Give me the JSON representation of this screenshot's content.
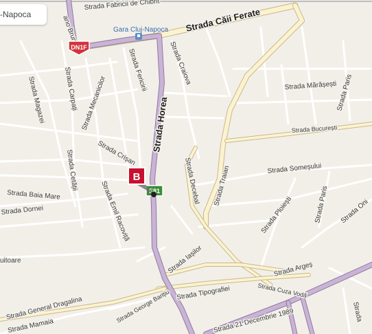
{
  "search_text": "-Napoca",
  "marker": {
    "label": "B",
    "color": "#c8102e"
  },
  "station_label": "Gara Cluj-Napoca",
  "shields": [
    {
      "label": "DN1F",
      "color": "#d2333b"
    },
    {
      "label": "E81",
      "color": "#3a8c3a"
    }
  ],
  "streets": [
    "Strada Căii Ferate",
    "Strada Fabricii de Chibrit",
    "ano Bruno",
    "Strada Horea",
    "Strada Fericirii",
    "Strada Craiova",
    "Strada Mecanicilor",
    "Strada Carpați",
    "Strada Magazei",
    "Strada Mărășești",
    "Strada Paris",
    "Strada București",
    "Strada Crișan",
    "Strada Traian",
    "Strada Decebal",
    "Strada Someșului",
    "Strada Baia Mare",
    "Strada Cetății",
    "Strada Dornei",
    "Strada Emil Racoviță",
    "Strada Ploiești",
    "Strada Paris",
    "Strada Oni",
    "Strada Iașilor",
    "Strada Argeș",
    "Strada Tipografiei",
    "Strada Cuza Vodă",
    "Strada George Barițiu",
    "Strada General Dragalina",
    "Strada Mamaia",
    "uitoare",
    "Strada 21 Decembrie 1989",
    "Strada"
  ],
  "colors": {
    "background": "#f2efe9",
    "minor_road": "#ffffff",
    "major_road": "#fbf3d0",
    "main_route": "#c9b4d6"
  }
}
